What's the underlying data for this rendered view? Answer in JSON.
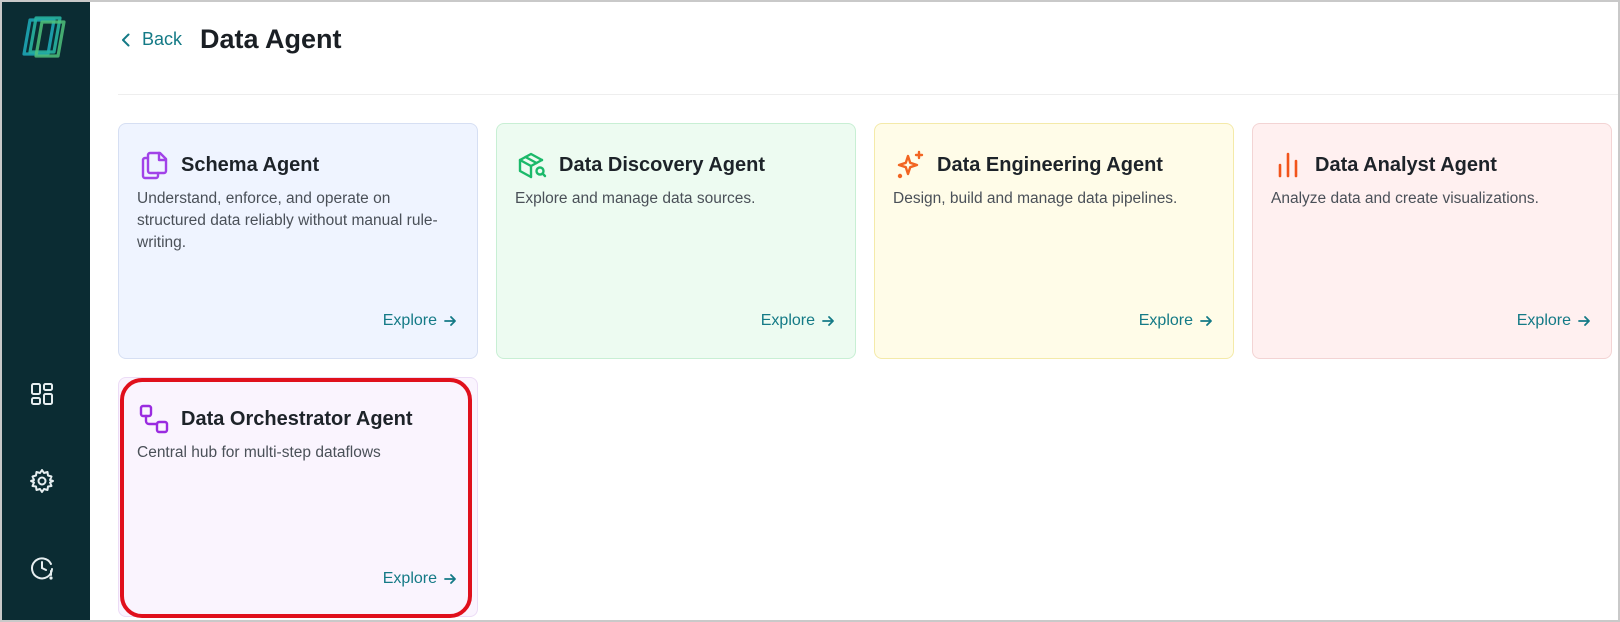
{
  "header": {
    "back_label": "Back",
    "title": "Data Agent"
  },
  "sidebar": {
    "icons": [
      "logo-icon",
      "dashboard-icon",
      "settings-gear-icon",
      "history-clock-icon"
    ]
  },
  "cards": [
    {
      "title": "Schema Agent",
      "description": "Understand, enforce, and operate on structured data reliably without manual rule-writing.",
      "action": "Explore",
      "icon": "schema-copy-icon",
      "accent": "#a142e8"
    },
    {
      "title": "Data Discovery Agent",
      "description": "Explore and manage data sources.",
      "action": "Explore",
      "icon": "package-search-icon",
      "accent": "#1bb96a"
    },
    {
      "title": "Data Engineering Agent",
      "description": "Design, build and manage data pipelines.",
      "action": "Explore",
      "icon": "sparkles-icon",
      "accent": "#f26522"
    },
    {
      "title": "Data Analyst Agent",
      "description": "Analyze data and create visualizations.",
      "action": "Explore",
      "icon": "bar-chart-icon",
      "accent": "#f2541b"
    },
    {
      "title": "Data Orchestrator Agent",
      "description": "Central hub for multi-step dataflows",
      "action": "Explore",
      "icon": "workflow-icon",
      "accent": "#9a2be0"
    }
  ],
  "colors": {
    "sidebar_bg": "#0b2c33",
    "link": "#147a86",
    "highlight": "#e0101c"
  }
}
